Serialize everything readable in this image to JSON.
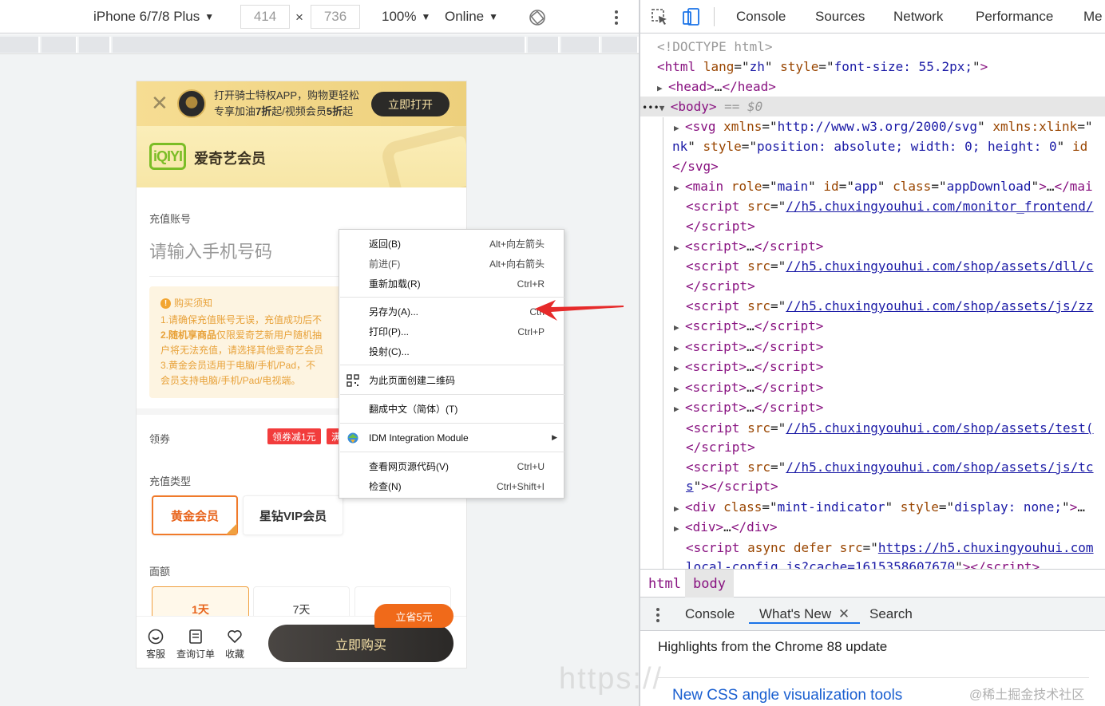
{
  "device_toolbar": {
    "device": "iPhone 6/7/8 Plus",
    "width": "414",
    "height": "736",
    "times": "×",
    "zoom": "100%",
    "network": "Online"
  },
  "mobile": {
    "banner": {
      "line1": "打开骑士特权APP，购物更轻松",
      "line2_pre": "专享加油",
      "line2_b1": "7折",
      "line2_mid": "起/视频会员",
      "line2_b2": "5折",
      "line2_post": "起",
      "open_button": "立即打开"
    },
    "header": {
      "logo": "iQIYI",
      "title": "爱奇艺会员"
    },
    "account_label": "充值账号",
    "phone_placeholder": "请输入手机号码",
    "notice": {
      "title": "购买须知",
      "lines": [
        "1.请确保充值账号无误，充值成功后不",
        "2.随机享商品",
        "仅限爱奇艺新用户随机抽",
        "户将无法充值，请选择其他爱奇艺会员",
        "3.黄金会员适用于电脑/手机/Pad，不",
        "会员支持电脑/手机/Pad/电视端。"
      ]
    },
    "coupon_label": "领券",
    "coupon_tags": [
      "领券减1元",
      "满"
    ],
    "type_label": "充值类型",
    "vip_types": [
      "黄金会员",
      "星钻VIP会员"
    ],
    "amount_label": "面额",
    "amounts": [
      "1天",
      "7天"
    ],
    "save_tag": "立省5元",
    "bottom": {
      "service": "客服",
      "orders": "查询订单",
      "favorite": "收藏",
      "buy": "立即购买"
    }
  },
  "context_menu": {
    "items": [
      {
        "label": "返回(B)",
        "shortcut": "Alt+向左箭头"
      },
      {
        "label": "前进(F)",
        "shortcut": "Alt+向右箭头"
      },
      {
        "label": "重新加载(R)",
        "shortcut": "Ctrl+R"
      },
      {
        "label": "另存为(A)...",
        "shortcut": "Ctrl"
      },
      {
        "label": "打印(P)...",
        "shortcut": "Ctrl+P"
      },
      {
        "label": "投射(C)...",
        "shortcut": ""
      },
      {
        "label": "为此页面创建二维码",
        "shortcut": ""
      },
      {
        "label": "翻成中文（简体）(T)",
        "shortcut": ""
      },
      {
        "label": "IDM Integration Module",
        "shortcut": ""
      },
      {
        "label": "查看网页源代码(V)",
        "shortcut": "Ctrl+U"
      },
      {
        "label": "检查(N)",
        "shortcut": "Ctrl+Shift+I"
      }
    ]
  },
  "devtools": {
    "tabs": [
      "Console",
      "Sources",
      "Network",
      "Performance",
      "Me"
    ],
    "elements": {
      "doctype": "<!DOCTYPE html>",
      "html_lang": "zh",
      "html_style": "font-size: 55.2px;",
      "body_eq": "== $0",
      "svg_xmlns": "http://www.w3.org/2000/svg",
      "svg_xlink_attr": "xmlns:xlink",
      "svg_cont": "nk",
      "svg_style": "position: absolute; width: 0; height: 0",
      "svg_id": "id",
      "main_role": "main",
      "main_id": "app",
      "main_class": "appDownload",
      "src_monitor": "//h5.chuxingyouhui.com/monitor_frontend/",
      "src_dll": "//h5.chuxingyouhui.com/shop/assets/dll/c",
      "src_js_zz": "//h5.chuxingyouhui.com/shop/assets/js/zz",
      "src_test": "//h5.chuxingyouhui.com/shop/assets/test(",
      "src_js_tc": "//h5.chuxingyouhui.com/shop/assets/js/tc",
      "src_js_tc_end": "s",
      "div_class": "mint-indicator",
      "div_style": "display: none;",
      "async_src": "https://h5.chuxingyouhui.com",
      "async_src_cont": "local-config.js?cache=1615358607670"
    },
    "breadcrumbs": [
      "html",
      "body"
    ],
    "drawer_tabs": [
      "Console",
      "What's New",
      "Search"
    ],
    "highlights": "Highlights from the Chrome 88 update",
    "feature": "New CSS angle visualization tools"
  },
  "watermarks": {
    "left": "https://",
    "right": "@稀土掘金技术社区"
  }
}
